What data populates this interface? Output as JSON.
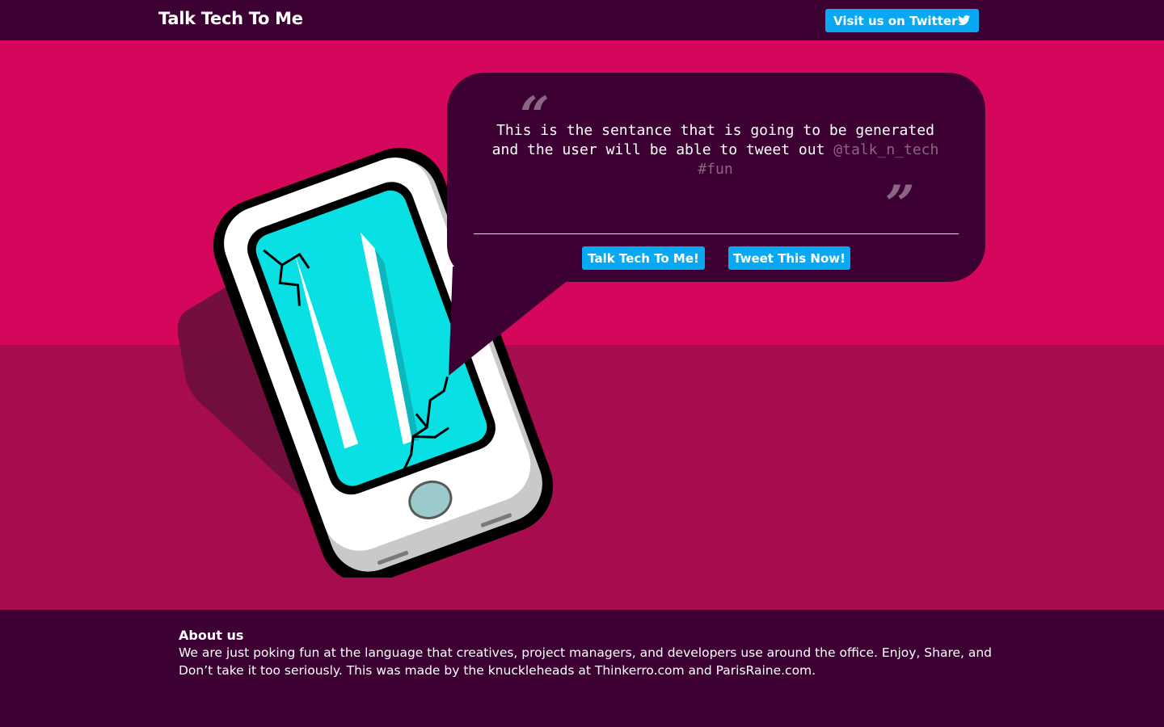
{
  "header": {
    "brand": "Talk Tech To Me",
    "twitter_button": "Visit us on Twitter",
    "twitter_icon": "twitter-bird-icon"
  },
  "quote": {
    "text": "This is the sentance that is going to be generated and the user will be able to tweet out",
    "handle": "@talk_n_tech #fun",
    "open_mark": "“",
    "close_mark": "”"
  },
  "actions": {
    "talk_button": "Talk Tech To Me!",
    "tweet_button": "Tweet This Now!"
  },
  "footer": {
    "title": "About us",
    "text": "We are just poking fun at the language that creatives, project managers, and developers use around the office. Enjoy, Share, and Don’t take it too seriously. This was made by the knuckleheads at Thinkerro.com and ParisRaine.com."
  },
  "colors": {
    "dark": "#3c0033",
    "hero_top": "#d4075c",
    "hero_bottom": "#a60c4e",
    "button": "#08a9f2",
    "screen": "#08e0e4",
    "handle": "#8a6683"
  }
}
